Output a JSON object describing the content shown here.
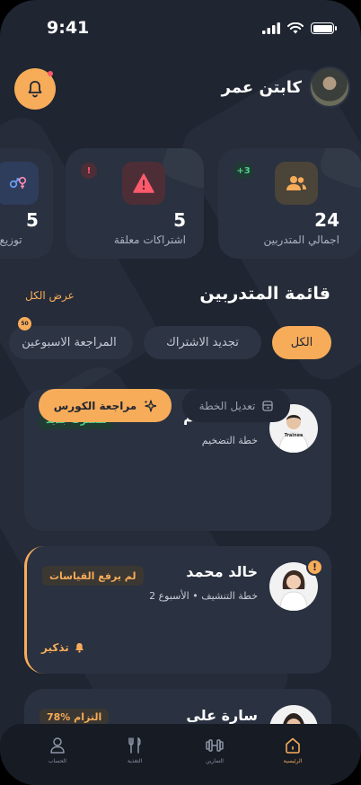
{
  "status_bar": {
    "time": "9:41"
  },
  "header": {
    "coach_name": "كابتن عمر"
  },
  "stats": [
    {
      "label": "اجمالي المتدربين",
      "value": "24",
      "badge": "+3",
      "icon": "users-icon"
    },
    {
      "label": "اشتراكات معلقة",
      "value": "5",
      "badge": "!",
      "icon": "warning-icon"
    },
    {
      "label": "توزيع الج",
      "value": "5",
      "icon": "gender-icon"
    }
  ],
  "section": {
    "title": "قائمة المتدربين",
    "view_all": "عرض الكل"
  },
  "filters": [
    {
      "label": "الكل",
      "active": true
    },
    {
      "label": "تجديد الاشتراك"
    },
    {
      "label": "المراجعة الاسبوعين",
      "count": "50"
    }
  ],
  "trainees": [
    {
      "name": "أحمد سالم",
      "plan": "خطة التضخيم",
      "tag": "مشترك جديد",
      "avatar_caption": "Trainee",
      "edit_label": "تعديل الخطة",
      "review_label": "مراجعة الكورس"
    },
    {
      "name": "خالد محمد",
      "plan": "خطة التنشيف • الأسبوع 2",
      "tag": "لم يرفع القياسات",
      "alert": "!",
      "remind_label": "تذكير"
    },
    {
      "name": "سارة على",
      "tag": "78% التزام"
    }
  ],
  "nav": [
    {
      "label": "الرئيسية",
      "icon": "home-icon",
      "active": true
    },
    {
      "label": "التمارين",
      "icon": "dumbbell-icon"
    },
    {
      "label": "التغذية",
      "icon": "fork-knife-icon"
    },
    {
      "label": "الحساب",
      "icon": "user-icon"
    }
  ],
  "colors": {
    "accent": "#f7ac5a",
    "background": "#1f2531",
    "card": "#2a3140",
    "success": "#4cd387",
    "danger": "#ff5a6b"
  }
}
